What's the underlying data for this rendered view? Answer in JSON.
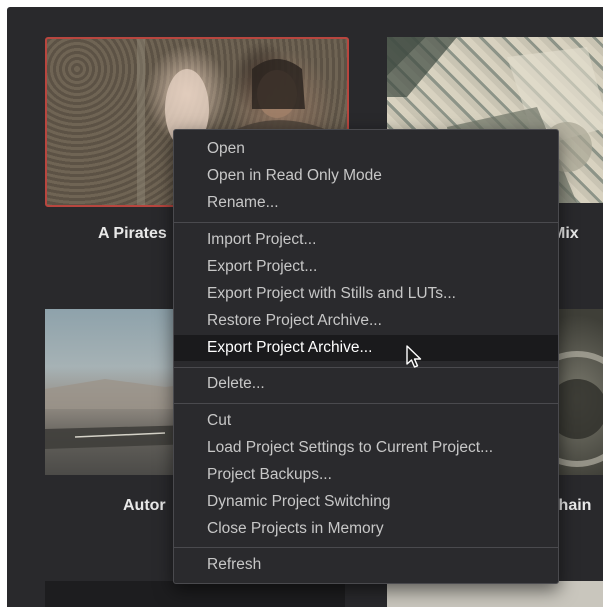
{
  "projects": [
    {
      "title": "A Pirates",
      "thumbnail": "pirates-scene"
    },
    {
      "title": "Mix",
      "thumbnail": "comic-art"
    },
    {
      "title": "Autor",
      "thumbnail": "desert-road"
    },
    {
      "title": "Chain",
      "thumbnail": "dark-machine"
    }
  ],
  "context_menu": {
    "items": [
      {
        "label": "Open"
      },
      {
        "label": "Open in Read Only Mode"
      },
      {
        "label": "Rename..."
      },
      {
        "label": "Import Project..."
      },
      {
        "label": "Export Project..."
      },
      {
        "label": "Export Project with Stills and LUTs..."
      },
      {
        "label": "Restore Project Archive..."
      },
      {
        "label": "Export Project Archive...",
        "highlighted": true
      },
      {
        "label": "Delete..."
      },
      {
        "label": "Cut"
      },
      {
        "label": "Load Project Settings to Current Project..."
      },
      {
        "label": "Project Backups..."
      },
      {
        "label": "Dynamic Project Switching"
      },
      {
        "label": "Close Projects in Memory"
      },
      {
        "label": "Refresh"
      }
    ]
  },
  "colors": {
    "background": "#29292c",
    "menu_background": "#2a2a2d",
    "menu_highlight": "#1a1a1c",
    "selected_border": "#b8463f"
  }
}
